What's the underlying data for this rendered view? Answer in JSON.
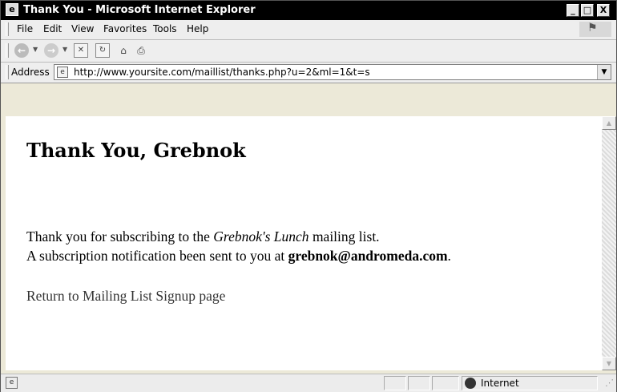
{
  "window": {
    "title": "Thank You - Microsoft Internet Explorer",
    "controls": {
      "minimize": "_",
      "maximize": "□",
      "close": "X"
    }
  },
  "menu": {
    "items": [
      "File",
      "Edit",
      "View",
      "Favorites",
      "Tools",
      "Help"
    ]
  },
  "toolbar": {
    "buttons": [
      "back-icon",
      "forward-icon",
      "stop-icon",
      "refresh-icon",
      "home-icon",
      "print-icon"
    ]
  },
  "address": {
    "label": "Address",
    "url": "http://www.yoursite.com/maillist/thanks.php?u=2&ml=1&t=s"
  },
  "page": {
    "heading": "Thank You, Grebnok",
    "line1_prefix": "Thank you for subscribing to the ",
    "list_name": "Grebnok's Lunch",
    "line1_suffix": " mailing list.",
    "line2_prefix": "A subscription notification been sent to you at ",
    "email": "grebnok@andromeda.com",
    "line2_suffix": ".",
    "return_link": "Return to Mailing List Signup page"
  },
  "status": {
    "zone": "Internet"
  }
}
